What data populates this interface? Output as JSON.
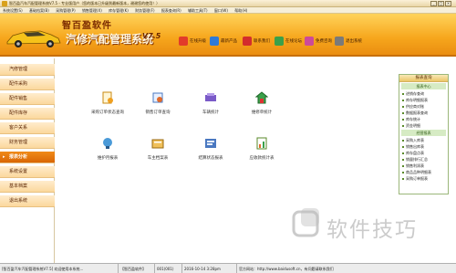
{
  "window": {
    "title": "智百盈汽车汽配管理系统V7.5 - 专业版用户（您的版本已升级到最新版本，谢谢您的使用！）",
    "controls": [
      "_",
      "□",
      "×"
    ]
  },
  "menu": [
    "系统设置(S)",
    "基础档案(B)",
    "采购管理(P)",
    "销售管理(X)",
    "库存管理(K)",
    "财务管理(F)",
    "报表查询(R)",
    "辅助工具(T)",
    "窗口(W)",
    "帮助(H)"
  ],
  "banner": {
    "brand_line1": "智百盈软件",
    "brand_line2": "汽修汽配管理系统",
    "version": "V7.5",
    "quick_buttons": [
      {
        "label": "在线升级",
        "icon": "globe-icon",
        "color": "#e23b2a"
      },
      {
        "label": "最新产品",
        "icon": "box-icon",
        "color": "#2f7ad8"
      },
      {
        "label": "联系我们",
        "icon": "phone-icon",
        "color": "#d32d2d"
      },
      {
        "label": "在线论坛",
        "icon": "forum-icon",
        "color": "#3aa04a"
      },
      {
        "label": "免费咨询",
        "icon": "chat-icon",
        "color": "#cc4a9a"
      },
      {
        "label": "退出系统",
        "icon": "exit-icon",
        "color": "#7a7a7a"
      }
    ]
  },
  "nav": {
    "items": [
      "汽修管理",
      "配件采购",
      "配件销售",
      "配件库存",
      "客户关系",
      "财务管理",
      "报表分析",
      "系统设置",
      "基本档案",
      "退出系统"
    ],
    "active_index": 6
  },
  "main": {
    "icons": [
      {
        "label": "采购订单状态查询",
        "icon": "purchase-order-icon"
      },
      {
        "label": "销售订单查询",
        "icon": "sales-order-icon"
      },
      {
        "label": "车辆统计",
        "icon": "vehicle-stats-icon"
      },
      {
        "label": "维修单统计",
        "icon": "repair-stats-icon"
      },
      {
        "label": "维护月报表",
        "icon": "maintenance-report-icon"
      },
      {
        "label": "车主档案表",
        "icon": "owner-file-icon"
      },
      {
        "label": "结算状态报表",
        "icon": "settlement-report-icon"
      },
      {
        "label": "应收款统计表",
        "icon": "receivable-stats-icon"
      }
    ]
  },
  "right_panel": {
    "title": "报表查询",
    "sections": [
      {
        "heading": "报表中心",
        "items": [
          "进销存查询",
          "库存明细报表",
          "供应商对账",
          "数据报表查询",
          "库存统计",
          "资金明细"
        ]
      },
      {
        "heading": "经营报表",
        "items": [
          "采购入库表",
          "销售出库表",
          "库存盘点表",
          "销量排行汇总",
          "销售利润表",
          "商品品种明细表",
          "采购订单报表"
        ]
      }
    ]
  },
  "status": {
    "cells": [
      "[智百盈汽车汽配管理系统V7.5] 欢迎使用本系统...",
      "【智百盈软件】",
      "001(001)",
      "2016-10-14 3:28pm",
      "官方网站：http://www.baidusoft.cn，有问题请联系我们"
    ]
  },
  "watermark": {
    "text": "软件技巧"
  }
}
